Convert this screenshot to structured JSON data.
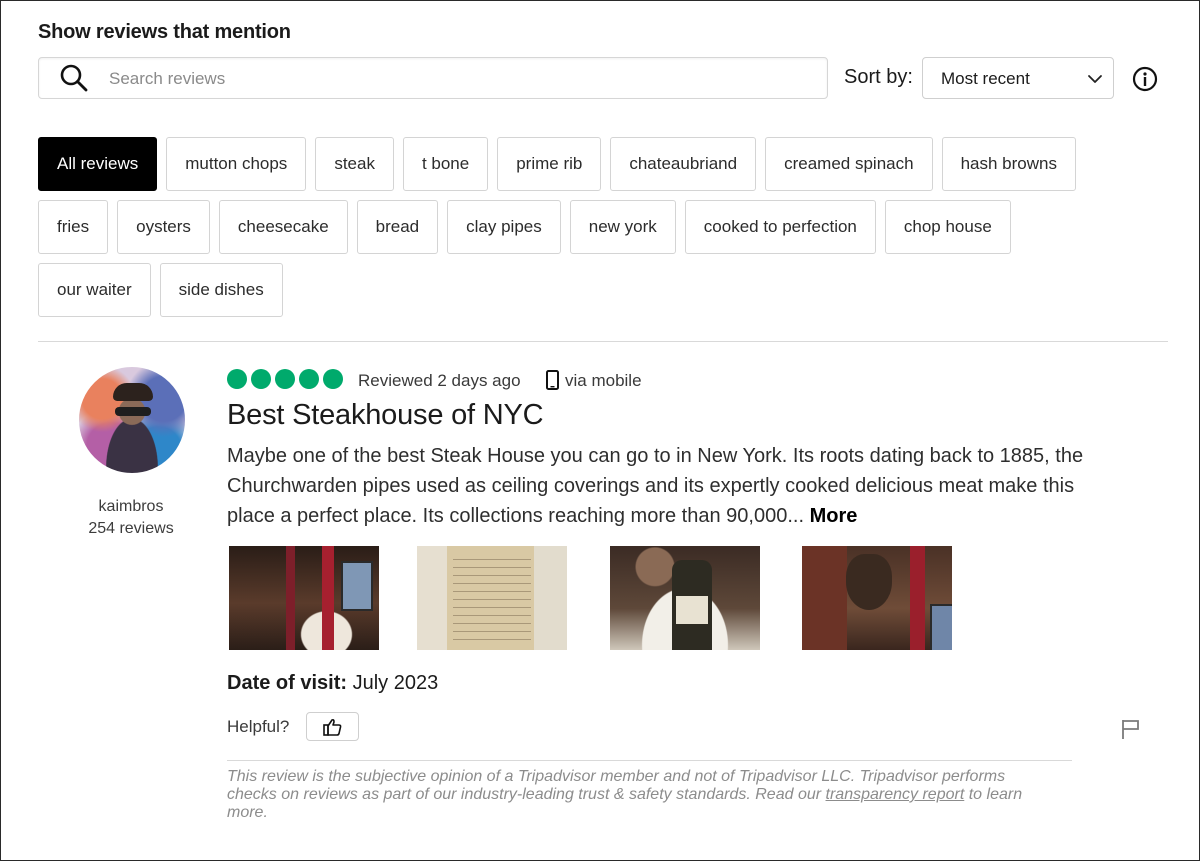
{
  "header": {
    "title": "Show reviews that mention",
    "search": {
      "placeholder": "Search reviews",
      "value": ""
    },
    "sort": {
      "label": "Sort by:",
      "selected": "Most recent"
    }
  },
  "filters": {
    "rows": [
      [
        "All reviews",
        "mutton chops",
        "steak",
        "t bone",
        "prime rib",
        "chateaubriand",
        "creamed spinach",
        "hash browns"
      ],
      [
        "fries",
        "oysters",
        "cheesecake",
        "bread",
        "clay pipes",
        "new york",
        "cooked to perfection",
        "chop house"
      ],
      [
        "our waiter",
        "side dishes"
      ]
    ],
    "active": "All reviews"
  },
  "review": {
    "username": "kaimbros",
    "review_count": "254 reviews",
    "rating": 5,
    "reviewed_when": "Reviewed 2 days ago",
    "via": "via mobile",
    "title": "Best Steakhouse of NYC",
    "body": "Maybe one of the best Steak House you can go to in New York. Its roots dating back to 1885, the Churchwarden pipes used as ceiling coverings and its expertly cooked delicious meat make this place a perfect place. Its collections reaching more than 90,000...",
    "more_label": "More",
    "date_of_visit_label": "Date of visit:",
    "date_of_visit_value": "July 2023",
    "helpful_label": "Helpful?",
    "disclaimer_text": "This review is the subjective opinion of a Tripadvisor member and not of Tripadvisor LLC. Tripadvisor performs checks on reviews as part of our industry-leading trust & safety standards. Read our",
    "disclaimer_link": "transparency report",
    "disclaimer_end": "to learn more."
  },
  "colors": {
    "rating_bubble": "#00aa6c",
    "chip_active_bg": "#000000",
    "muted_text": "#8c8c8c"
  },
  "icons": [
    "search-icon",
    "chevron-down-icon",
    "info-icon",
    "mobile-phone-icon",
    "thumbs-up-icon",
    "flag-icon"
  ]
}
